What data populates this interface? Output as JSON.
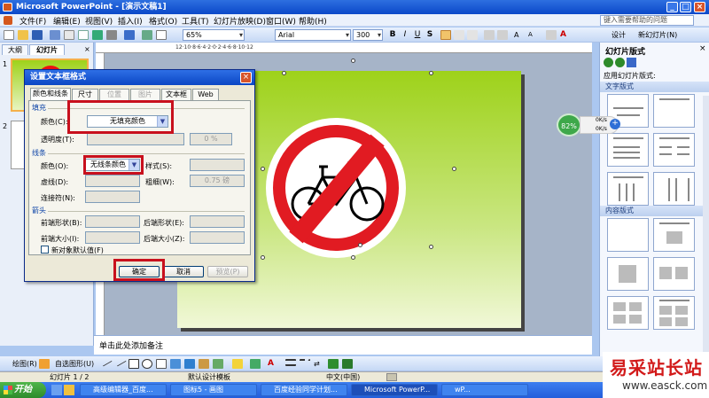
{
  "window": {
    "title": "Microsoft PowerPoint - [演示文稿1]",
    "min": "_",
    "max": "□",
    "close": "×"
  },
  "menu": {
    "items": [
      "文件(F)",
      "编辑(E)",
      "视图(V)",
      "插入(I)",
      "格式(O)",
      "工具(T)",
      "幻灯片放映(D)",
      "窗口(W)",
      "帮助(H)"
    ],
    "help_placeholder": "键入需要帮助的问题"
  },
  "toolbar": {
    "zoom": "65%",
    "font": "Arial",
    "size": "300",
    "design": "设计",
    "new_slide": "新幻灯片(N)"
  },
  "left_panel": {
    "tab_outline": "大纲",
    "tab_slides": "幻灯片",
    "slide_num_1": "1",
    "slide_num_2": "2"
  },
  "ruler": {
    "marks": "12·10·8·6·4·2·0·2·4·6·8·10·12"
  },
  "notes": {
    "placeholder": "单击此处添加备注"
  },
  "task_pane": {
    "title": "幻灯片版式",
    "apply_label": "应用幻灯片版式:",
    "section_text": "文字版式",
    "section_content": "内容版式"
  },
  "dialog": {
    "title": "设置文本框格式",
    "close": "×",
    "tabs": [
      "颜色和线条",
      "尺寸",
      "位置",
      "图片",
      "文本框",
      "Web"
    ],
    "fill_group": "填充",
    "fill_color_label": "颜色(C):",
    "fill_color_value": "无填充颜色",
    "transparency_label": "透明度(T):",
    "transparency_value": "0 %",
    "line_group": "线条",
    "line_color_label": "颜色(O):",
    "line_color_value": "无线条颜色",
    "style_label": "样式(S):",
    "dashed_label": "虚线(D):",
    "weight_label": "粗细(W):",
    "weight_value": "0.75 磅",
    "connector_label": "连接符(N):",
    "arrows_group": "箭头",
    "begin_style_label": "前端形状(B):",
    "end_style_label": "后端形状(E):",
    "begin_size_label": "前端大小(I):",
    "end_size_label": "后端大小(Z):",
    "default_checkbox_label": "新对象默认值(F)",
    "ok_label": "确定",
    "cancel_label": "取消",
    "preview_label": "预览(P)"
  },
  "netmeter": {
    "percent": "82%",
    "up": "0K/s",
    "down": "0K/s"
  },
  "drawing_toolbar": {
    "draw": "绘图(R)",
    "autoshapes": "自选图形(U)"
  },
  "status": {
    "slide": "幻灯片 1 / 2",
    "design": "默认设计模板",
    "language": "中文(中国)"
  },
  "taskbar": {
    "start": "开始",
    "tasks": [
      "高级编辑器_百度...",
      "图标5 - 画图",
      "百度经验同学计划...",
      "Microsoft PowerP...",
      "wP..."
    ]
  },
  "watermark": {
    "brand": "易采站长站",
    "url": "www.easck.com"
  }
}
